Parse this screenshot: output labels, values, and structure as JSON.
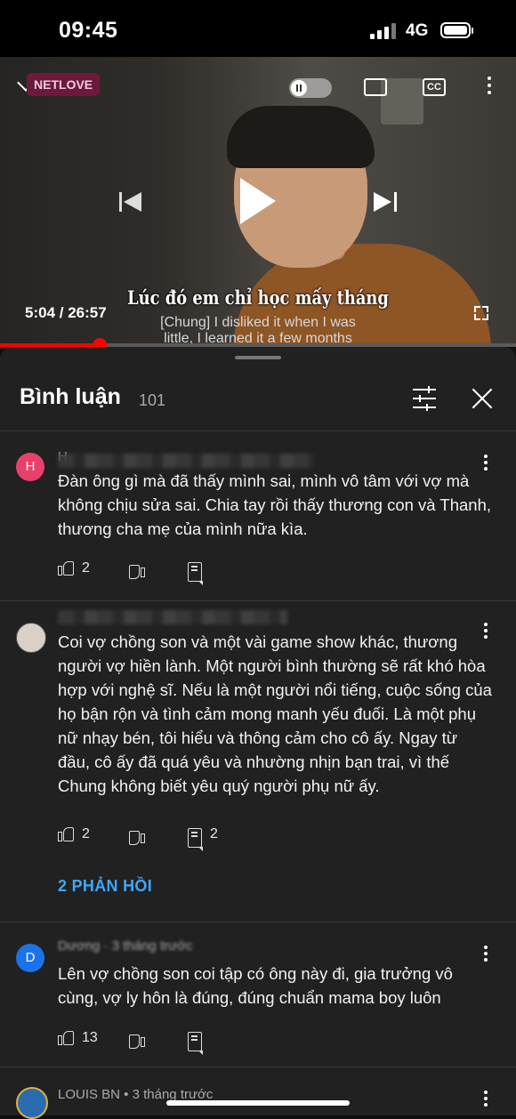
{
  "status_bar": {
    "time": "09:45",
    "network": "4G"
  },
  "video": {
    "channel_logo": "NETLOVE",
    "cc_label": "CC",
    "subtitle_vi": "Lúc đó em chỉ học mấy tháng",
    "subtitle_en_line1": "[Chung] I disliked it when I was",
    "subtitle_en_line2": "little, I learned it a few months",
    "time_display": "5:04 / 26:57",
    "progress": 0.193,
    "buffered": 0.25
  },
  "comments_panel": {
    "title": "Bình luận",
    "count": "101"
  },
  "comments": [
    {
      "avatar_letter": "H",
      "avatar_color": "#e8406c",
      "author_visible": "H",
      "text": "Đàn ông gì mà đã thấy mình sai, mình vô tâm với vợ mà không chịu sửa sai. Chia tay rồi thấy thương con và Thanh, thương cha mẹ của mình nữa kìa.",
      "likes": "2",
      "replies_count": ""
    },
    {
      "avatar_letter": "",
      "avatar_color": "#d9d0c8",
      "author_visible": "",
      "text": "Coi vợ chồng son và một vài game show khác, thương người vợ hiền lành. Một người bình thường sẽ rất khó hòa hợp với nghệ sĩ. Nếu là một người nổi tiếng, cuộc sống của họ bận rộn và tình cảm mong manh yếu đuối. Là một phụ nữ nhạy bén, tôi hiểu và thông cảm cho cô ấy. Ngay từ đầu, cô ấy đã quá yêu và nhường nhịn bạn trai, vì thế Chung không biết yêu quý người phụ nữ ấy.",
      "likes": "2",
      "replies_count": "2",
      "replies_link": "2 PHẢN HỒI"
    },
    {
      "avatar_letter": "D",
      "avatar_color": "#1a73e8",
      "author_visible": "Dương · 3 tháng trước",
      "text": "Lên vợ chồng son coi tập có ông này đi, gia trưởng vô cùng, vợ ly hôn là đúng, đúng chuẩn mama boy luôn",
      "likes": "13",
      "replies_count": ""
    },
    {
      "avatar_letter": "",
      "avatar_color": "#2b6cb0",
      "author_visible": "LOUIS BN • 3 tháng trước",
      "text": "",
      "likes": "",
      "replies_count": ""
    }
  ]
}
